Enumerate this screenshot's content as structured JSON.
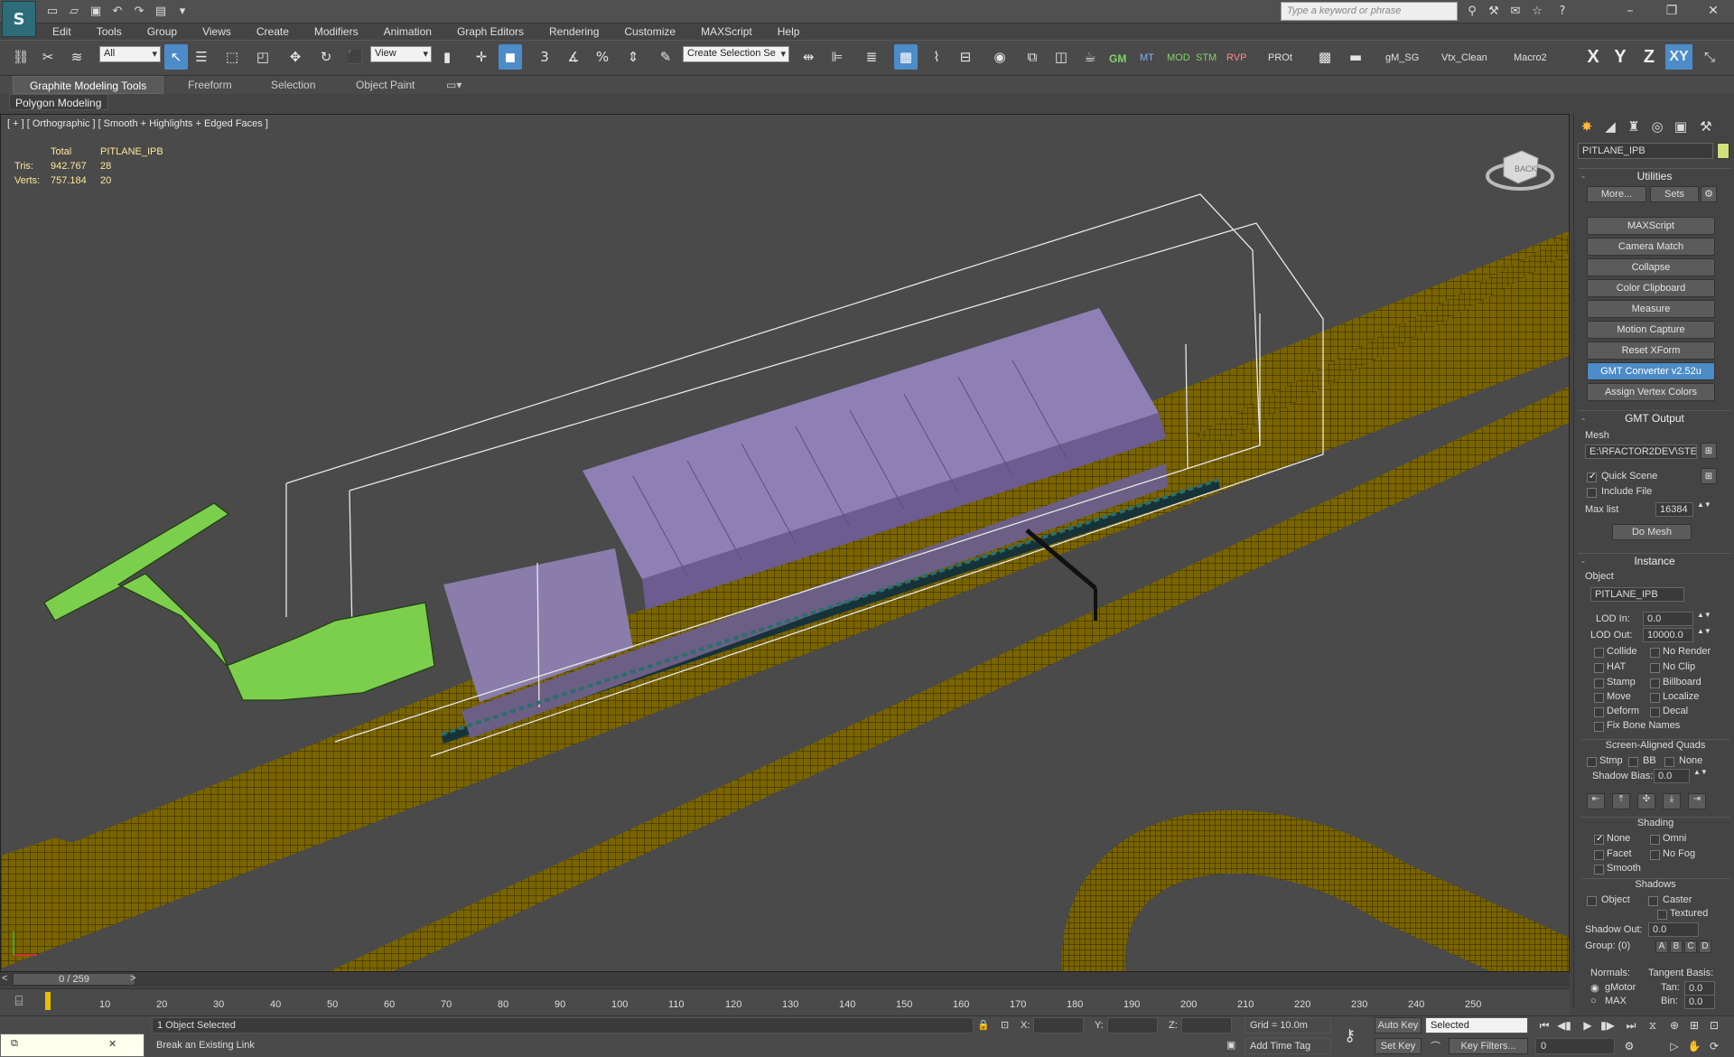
{
  "search": {
    "placeholder": "Type a keyword or phrase"
  },
  "menu": [
    "Edit",
    "Tools",
    "Group",
    "Views",
    "Create",
    "Modifiers",
    "Animation",
    "Graph Editors",
    "Rendering",
    "Customize",
    "MAXScript",
    "Help"
  ],
  "toolbar": {
    "filter": "All",
    "ref_coord": "View",
    "selection_set": "Create Selection Se",
    "snap_label": "3",
    "tags": [
      "GM",
      "MT",
      "MOD",
      "STM",
      "RVP",
      "PROt",
      "gM_SG",
      "Vtx_Clean",
      "Macro2"
    ]
  },
  "axes": [
    "X",
    "Y",
    "Z",
    "XY"
  ],
  "ribbon": {
    "tabs": [
      "Graphite Modeling Tools",
      "Freeform",
      "Selection",
      "Object Paint"
    ],
    "panel": "Polygon Modeling"
  },
  "viewport": {
    "label": "[ + ] [ Orthographic ] [ Smooth + Highlights + Edged Faces ]",
    "stats": {
      "h_total": "Total",
      "h_obj": "PITLANE_IPB",
      "tris_label": "Tris:",
      "tris_total": "942.767",
      "tris_obj": "28",
      "verts_label": "Verts:",
      "verts_total": "757.184",
      "verts_obj": "20"
    }
  },
  "command": {
    "object_name": "PITLANE_IPB",
    "utilities": {
      "title": "Utilities",
      "more": "More...",
      "sets": "Sets",
      "items": [
        "MAXScript",
        "Camera Match",
        "Collapse",
        "Color Clipboard",
        "Measure",
        "Motion Capture",
        "Reset XForm",
        "GMT Converter v2.52u",
        "Assign Vertex Colors"
      ]
    },
    "gmt": {
      "title": "GMT Output",
      "mesh_label": "Mesh",
      "mesh_path": "E:\\RFACTOR2DEV\\STEA",
      "quick_scene": "Quick Scene",
      "include_file": "Include File",
      "max_list_label": "Max list",
      "max_list": "16384",
      "do_mesh": "Do Mesh"
    },
    "instance": {
      "title": "Instance",
      "object_label": "Object",
      "object": "PITLANE_IPB",
      "lod_in_label": "LOD In:",
      "lod_in": "0.0",
      "lod_out_label": "LOD Out:",
      "lod_out": "10000.0",
      "flags_left": [
        "Collide",
        "HAT",
        "Stamp",
        "Move",
        "Deform",
        "Fix Bone Names"
      ],
      "flags_right": [
        "No Render",
        "No Clip",
        "Billboard",
        "Localize",
        "Decal"
      ],
      "saq": "Screen-Aligned Quads",
      "saq_opts": [
        "Stmp",
        "BB",
        "None"
      ],
      "shadow_bias_label": "Shadow Bias:",
      "shadow_bias": "0.0",
      "shading": "Shading",
      "shade_left": [
        "None",
        "Facet",
        "Smooth"
      ],
      "shade_right": [
        "Omni",
        "No Fog"
      ],
      "shadows": "Shadows",
      "sh_object": "Object",
      "sh_caster": "Caster",
      "sh_textured": "Textured",
      "shadow_out_label": "Shadow Out:",
      "shadow_out": "0.0",
      "group_label": "Group: (0)",
      "groups": [
        "A",
        "B",
        "C",
        "D"
      ],
      "normals_label": "Normals:",
      "tangent_label": "Tangent Basis:",
      "gmotor": "gMotor",
      "max": "MAX",
      "tan_label": "Tan:",
      "tan": "0.0",
      "bin_label": "Bin:",
      "bin": "0.0"
    }
  },
  "timeline": {
    "frame": "0 / 259",
    "ticks": [
      "10",
      "20",
      "30",
      "40",
      "50",
      "60",
      "70",
      "80",
      "90",
      "100",
      "110",
      "120",
      "130",
      "140",
      "150",
      "160",
      "170",
      "180",
      "190",
      "200",
      "210",
      "220",
      "230",
      "240",
      "250"
    ]
  },
  "status": {
    "selected": "1 Object Selected",
    "prompt": "Break an Existing Link",
    "x_label": "X:",
    "y_label": "Y:",
    "z_label": "Z:",
    "grid": "Grid = 10.0m",
    "add_time_tag": "Add Time Tag",
    "auto_key": "Auto Key",
    "set_key": "Set Key",
    "key_mode": "Selected",
    "key_filters": "Key Filters...",
    "frame_value": "0"
  }
}
